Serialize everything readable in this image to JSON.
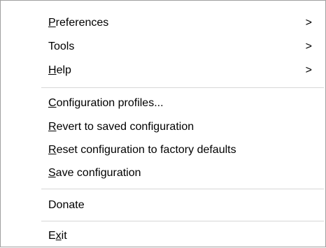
{
  "menu": {
    "items": [
      {
        "label": "Preferences",
        "mnemonic": "P",
        "submenu": true,
        "arrow": ">"
      },
      {
        "label": "Tools",
        "mnemonic": "",
        "submenu": true,
        "arrow": ">"
      },
      {
        "label": "Help",
        "mnemonic": "H",
        "submenu": true,
        "arrow": ">"
      },
      {
        "label": "Configuration profiles...",
        "mnemonic": "C",
        "submenu": false
      },
      {
        "label": "Revert to saved configuration",
        "mnemonic": "R",
        "submenu": false
      },
      {
        "label": "Reset configuration to factory defaults",
        "mnemonic": "R",
        "submenu": false
      },
      {
        "label": "Save configuration",
        "mnemonic": "S",
        "submenu": false
      },
      {
        "label": "Donate",
        "mnemonic": "",
        "submenu": false
      },
      {
        "label": "Exit",
        "mnemonic": "x",
        "submenu": false
      }
    ]
  }
}
